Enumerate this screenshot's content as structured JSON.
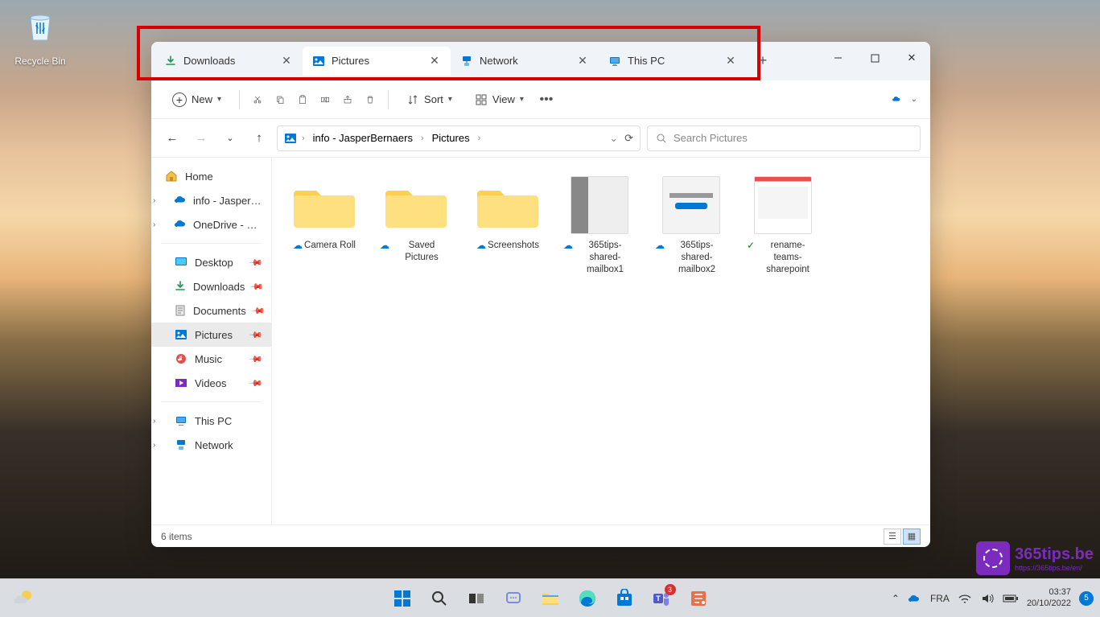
{
  "desktop": {
    "recycle_bin": "Recycle Bin"
  },
  "tabs": [
    {
      "name": "Downloads",
      "icon": "download"
    },
    {
      "name": "Pictures",
      "icon": "pictures",
      "active": true
    },
    {
      "name": "Network",
      "icon": "network"
    },
    {
      "name": "This PC",
      "icon": "pc"
    }
  ],
  "toolbar": {
    "new": "New",
    "sort": "Sort",
    "view": "View"
  },
  "breadcrumb": {
    "root": "info - JasperBernaers",
    "current": "Pictures"
  },
  "search": {
    "placeholder": "Search Pictures"
  },
  "sidebar": {
    "home": "Home",
    "onedrive_info": "info - JasperBernae",
    "onedrive_personal": "OneDrive - Persona",
    "desktop": "Desktop",
    "downloads": "Downloads",
    "documents": "Documents",
    "pictures": "Pictures",
    "music": "Music",
    "videos": "Videos",
    "thispc": "This PC",
    "network": "Network"
  },
  "items": [
    {
      "name": "Camera Roll",
      "type": "folder",
      "sync": "cloud"
    },
    {
      "name": "Saved Pictures",
      "type": "folder",
      "sync": "cloud"
    },
    {
      "name": "Screenshots",
      "type": "folder",
      "sync": "cloud"
    },
    {
      "name": "365tips-shared-mailbox1",
      "type": "image",
      "sync": "cloud"
    },
    {
      "name": "365tips-shared-mailbox2",
      "type": "image",
      "sync": "cloud"
    },
    {
      "name": "rename-teams-sharepoint",
      "type": "image",
      "sync": "check"
    }
  ],
  "status": {
    "count": "6 items"
  },
  "systray": {
    "lang": "FRA",
    "time": "03:37",
    "date": "20/10/2022",
    "notif": "5"
  },
  "watermark": {
    "text": "365tips.be",
    "url": "https://365tips.be/en/"
  }
}
